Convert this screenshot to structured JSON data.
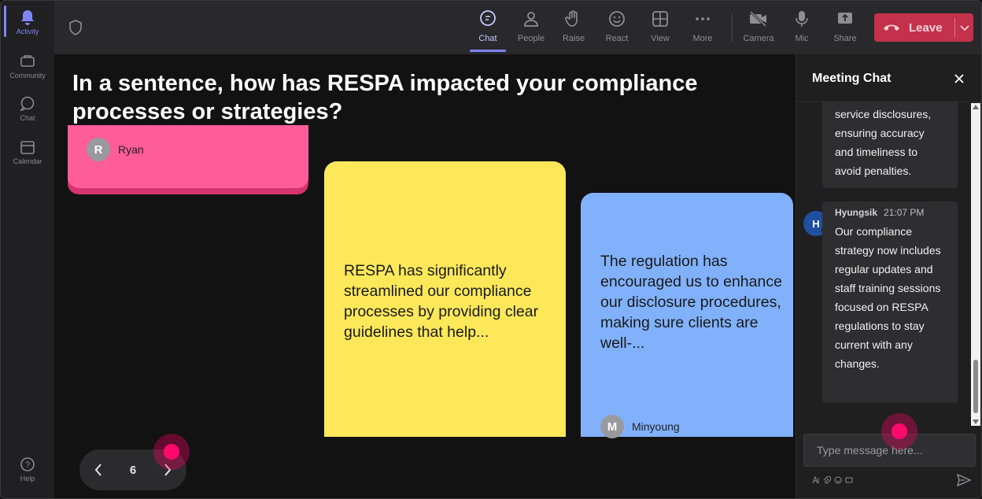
{
  "rail": {
    "items": [
      {
        "label": "Activity",
        "icon": "bell-icon",
        "active": true
      },
      {
        "label": "Community",
        "icon": "community-icon"
      },
      {
        "label": "Chat",
        "icon": "chat-icon"
      },
      {
        "label": "Calendar",
        "icon": "calendar-icon"
      },
      {
        "label": "Help",
        "icon": "help-icon"
      }
    ]
  },
  "toolbar": {
    "chat": "Chat",
    "people": "People",
    "raise": "Raise",
    "react": "React",
    "view": "View",
    "more": "More",
    "camera": "Camera",
    "mic": "Mic",
    "share": "Share",
    "leave": "Leave"
  },
  "stage": {
    "question": "In a sentence, how has RESPA impacted your compliance processes or strategies?",
    "notes": [
      {
        "color": "#ff5c9a",
        "avatar_initial": "R",
        "author": "Ryan"
      },
      {
        "color": "#fde85a",
        "text": "RESPA has significantly streamlined our compliance processes by providing clear guidelines that help..."
      },
      {
        "color": "#81b1fb",
        "text": "The regulation has encouraged us to enhance our disclosure procedures, making sure clients are well-...",
        "avatar_initial": "M",
        "author": "Minyoung"
      }
    ],
    "pager": {
      "page": "6"
    }
  },
  "chat": {
    "title": "Meeting Chat",
    "messages": [
      {
        "text": "service disclosures, ensuring accuracy and timeliness to avoid penalties."
      },
      {
        "avatar_initial": "H",
        "sender": "Hyungsik",
        "time": "21:07 PM",
        "text": "Our compliance strategy now includes regular updates and staff training sessions focused on RESPA regulations to stay current with any changes."
      }
    ],
    "input_placeholder": "Type message here..."
  },
  "colors": {
    "accent": "#7f85f5",
    "leave": "#c4314b",
    "cursor": "#ff0a6c"
  }
}
